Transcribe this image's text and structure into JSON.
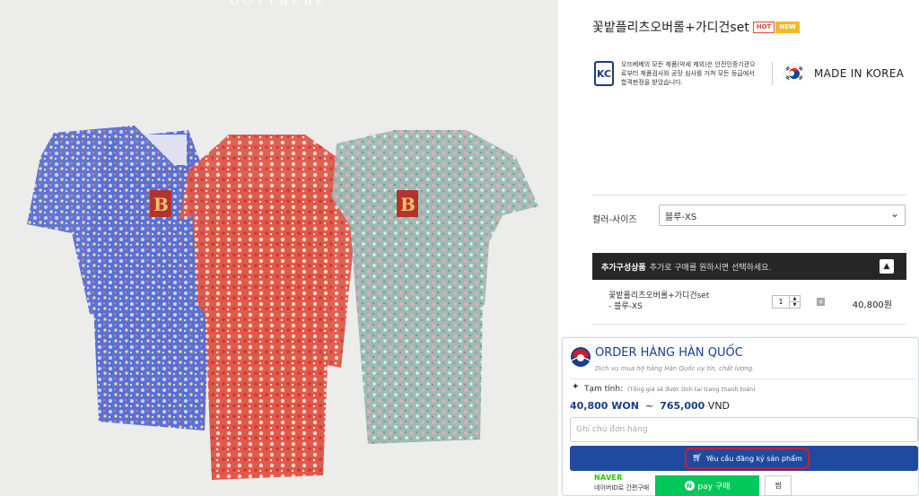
{
  "photo": {
    "watermark": "OOTTBEBE",
    "colors": {
      "background": "#ececea",
      "blue_print": "#5b6fd4",
      "red_print": "#e4574a",
      "mint_print": "#9bbcb5"
    }
  },
  "product": {
    "title": "꽃밭플리츠오버롤+가디건set",
    "badges": [
      "HOT",
      "NEW"
    ]
  },
  "certification": {
    "kc_mark": "KC",
    "text": "오뜨베베의 모든 제품(악세 제외)은 안전인증기관으로부터 제품검사와 공장 심사를 거쳐 모든 등급에서 합격판정을 받았습니다.",
    "made_in": "MADE IN KOREA"
  },
  "option": {
    "label": "컬러-사이즈",
    "selected": "블루-XS"
  },
  "addon": {
    "title": "추가구성상품",
    "desc": "추가로 구매를 원하시면 선택하세요.",
    "toggle": "▲"
  },
  "selected_item": {
    "name_line1": "꽃밭플리츠오버롤+가디건set",
    "name_line2": "- 블루-XS",
    "qty": "1",
    "remove": "✕",
    "price": "40,800원"
  },
  "order_widget": {
    "title": "ORDER HÀNG HÀN QUỐC",
    "subtitle": "Dịch vụ mua hộ hàng Hàn Quốc uy tín, chất lượng.",
    "temp_label": "Tạm tính:",
    "temp_note": "(Tổng giá sẽ được tính tại trang thanh toán)",
    "price_won": "40,800 WON",
    "price_sep": "~",
    "price_vnd": "765,000",
    "vnd_unit": "VND",
    "note_placeholder": "Ghi chú đơn hàng",
    "register_label": "Yêu cầu đăng ký sản phẩm",
    "accent_color": "#1f4aa0"
  },
  "naver": {
    "logo": "NAVER",
    "desc": "네이버ID로 간편구매",
    "pay_mark": "N",
    "pay_label": "pay 구매",
    "zzim": "찜"
  }
}
